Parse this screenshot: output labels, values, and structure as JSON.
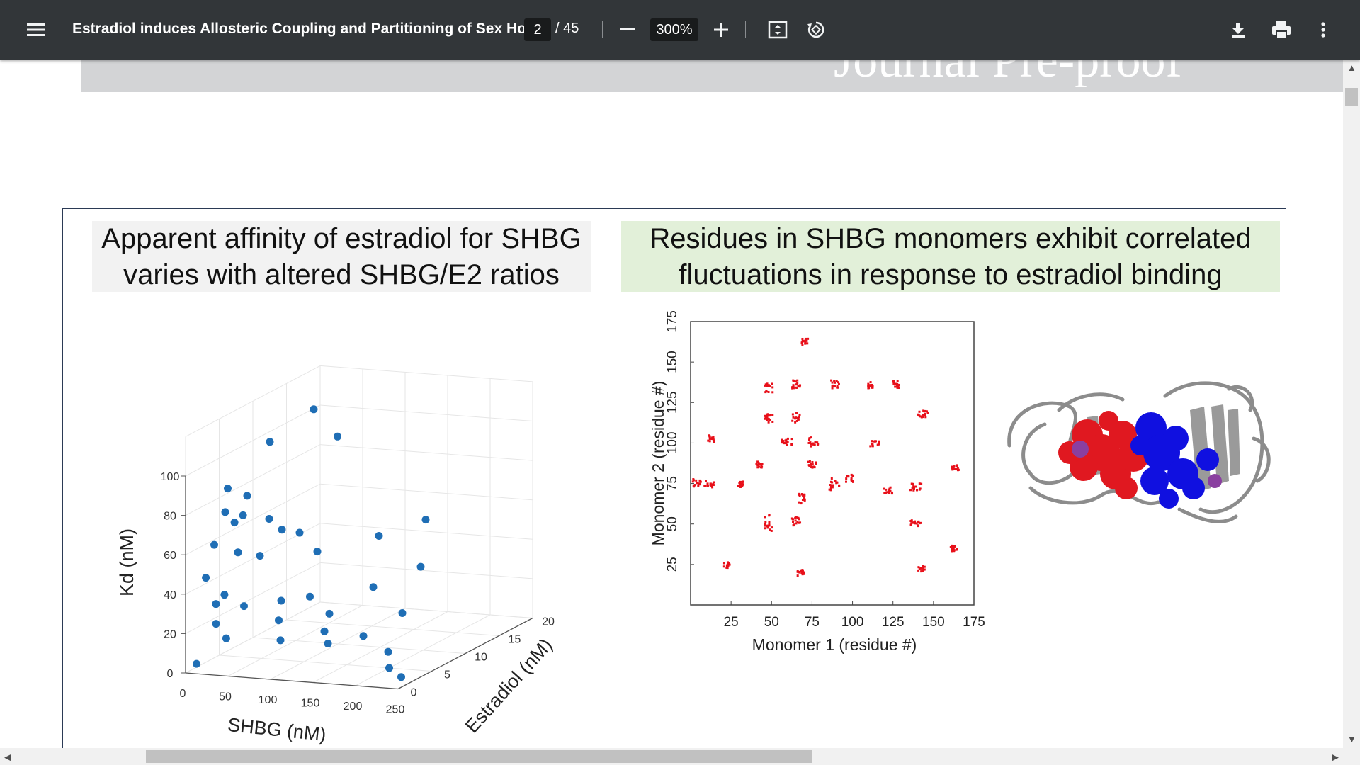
{
  "toolbar": {
    "title": "Estradiol induces Allosteric Coupling and Partitioning of Sex Ho...",
    "page_current": "2",
    "page_total": "/ 45",
    "zoom": "300%",
    "icons": [
      "menu-icon",
      "zoom-out-icon",
      "zoom-in-icon",
      "fit-page-icon",
      "rotate-icon",
      "download-icon",
      "print-icon",
      "more-vert-icon"
    ]
  },
  "document": {
    "watermark": "Journal Pre-proof",
    "left_panel_title": [
      "Apparent affinity of estradiol for SHBG",
      "varies with altered SHBG/E2 ratios"
    ],
    "right_panel_title": [
      "Residues in SHBG monomers exhibit correlated",
      "fluctuations in response to estradiol binding"
    ]
  },
  "colors": {
    "scatter": "#1f6eb5",
    "heatmap": "#e8101a",
    "protein_red": "#e01820",
    "protein_blue": "#1010e0",
    "protein_purple": "#8a3fa0",
    "title_green": "#e2f0d9",
    "title_gray": "#f2f2f2"
  },
  "chart_data": [
    {
      "type": "scatter",
      "title": "",
      "xlabel": "SHBG (nM)",
      "ylabel": "Estradiol (nM)",
      "zlabel": "Kd (nM)",
      "x_ticks": [
        "0",
        "50",
        "100",
        "150",
        "200",
        "250"
      ],
      "y_ticks": [
        "0",
        "5",
        "10",
        "15",
        "20"
      ],
      "z_ticks": [
        "0",
        "20",
        "40",
        "60",
        "80",
        "100"
      ],
      "xlim": [
        0,
        250
      ],
      "ylim": [
        0,
        20
      ],
      "zlim": [
        0,
        100
      ],
      "points": [
        {
          "x": 10,
          "y": 5,
          "z": 85
        },
        {
          "x": 10,
          "y": 3,
          "z": 60
        },
        {
          "x": 8,
          "y": 2,
          "z": 45
        },
        {
          "x": 12,
          "y": 3,
          "z": 30
        },
        {
          "x": 15,
          "y": 4,
          "z": 75
        },
        {
          "x": 18,
          "y": 5,
          "z": 68
        },
        {
          "x": 20,
          "y": 2,
          "z": 22
        },
        {
          "x": 22,
          "y": 3,
          "z": 35
        },
        {
          "x": 25,
          "y": 6,
          "z": 80
        },
        {
          "x": 28,
          "y": 5,
          "z": 72
        },
        {
          "x": 30,
          "y": 4,
          "z": 55
        },
        {
          "x": 32,
          "y": 2,
          "z": 15
        },
        {
          "x": 35,
          "y": 8,
          "z": 65
        },
        {
          "x": 40,
          "y": 6,
          "z": 50
        },
        {
          "x": 45,
          "y": 3,
          "z": 30
        },
        {
          "x": 50,
          "y": 8,
          "z": 60
        },
        {
          "x": 55,
          "y": 10,
          "z": 55
        },
        {
          "x": 60,
          "y": 12,
          "z": 42
        },
        {
          "x": 65,
          "y": 6,
          "z": 28
        },
        {
          "x": 70,
          "y": 5,
          "z": 20
        },
        {
          "x": 75,
          "y": 9,
          "z": 25
        },
        {
          "x": 80,
          "y": 4,
          "z": 12
        },
        {
          "x": 90,
          "y": 10,
          "z": 15
        },
        {
          "x": 100,
          "y": 8,
          "z": 10
        },
        {
          "x": 110,
          "y": 14,
          "z": 22
        },
        {
          "x": 120,
          "y": 6,
          "z": 8
        },
        {
          "x": 130,
          "y": 10,
          "z": 5
        },
        {
          "x": 150,
          "y": 16,
          "z": 30
        },
        {
          "x": 160,
          "y": 12,
          "z": 14
        },
        {
          "x": 175,
          "y": 8,
          "z": 2
        },
        {
          "x": 200,
          "y": 5,
          "z": 0
        },
        {
          "x": 40,
          "y": 14,
          "z": 110
        },
        {
          "x": 20,
          "y": 10,
          "z": 100
        },
        {
          "x": 60,
          "y": 15,
          "z": 95
        },
        {
          "x": 5,
          "y": 1,
          "z": 3
        },
        {
          "x": 85,
          "y": 18,
          "z": 40
        },
        {
          "x": 140,
          "y": 18,
          "z": 50
        },
        {
          "x": 230,
          "y": 3,
          "z": 0
        }
      ]
    },
    {
      "type": "heatmap",
      "title": "",
      "xlabel": "Monomer 1 (residue #)",
      "ylabel": "Monomer 2 (residue #)",
      "x_ticks": [
        "25",
        "50",
        "75",
        "100",
        "125",
        "150",
        "175"
      ],
      "y_ticks": [
        "25",
        "50",
        "75",
        "100",
        "125",
        "150",
        "175"
      ],
      "xlim": [
        0,
        175
      ],
      "ylim": [
        0,
        175
      ]
    }
  ]
}
